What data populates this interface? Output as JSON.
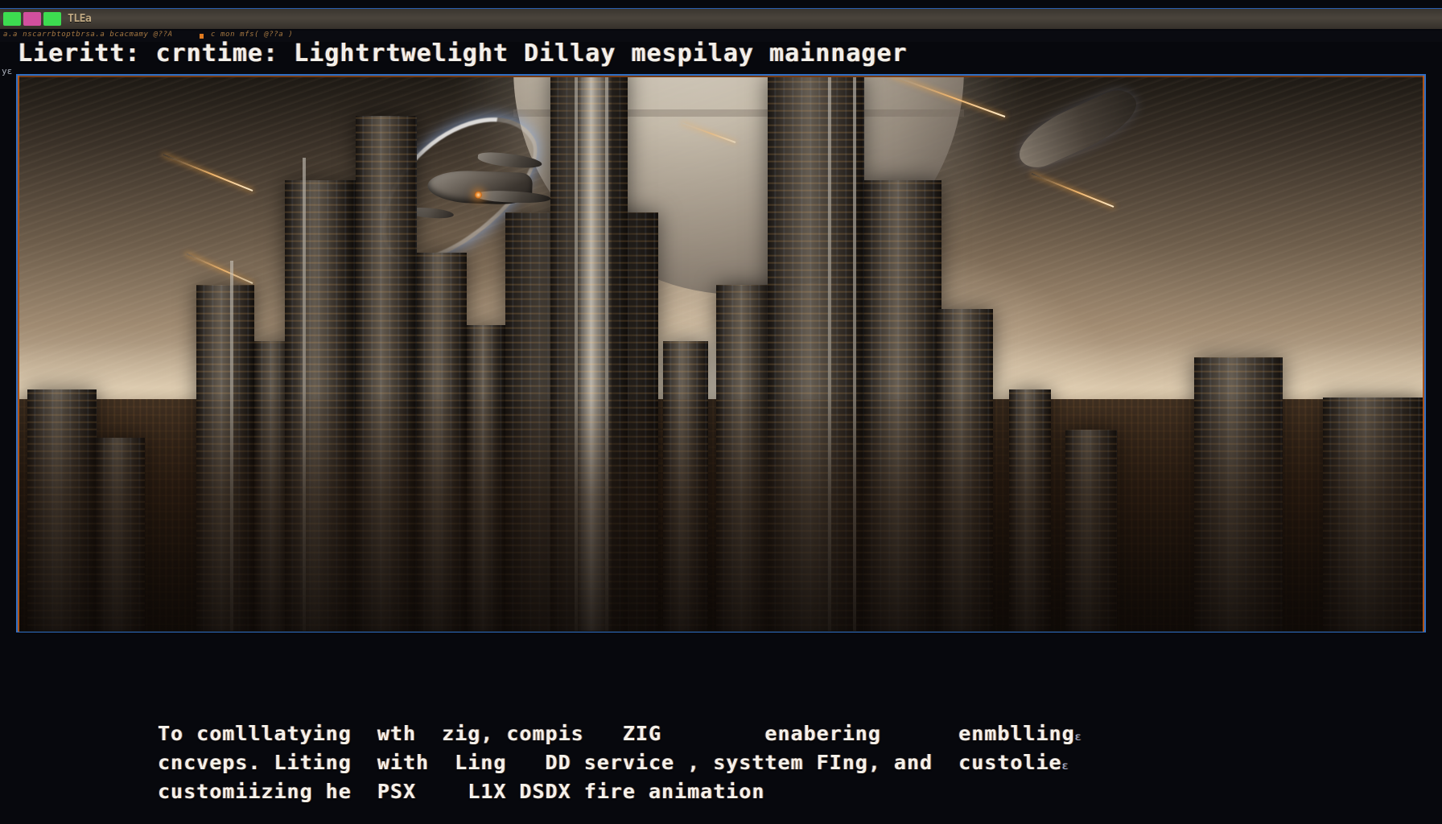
{
  "window": {
    "tabstrip": {
      "swatches": [
        {
          "name": "swatch-green-1",
          "color": "#3ddc50"
        },
        {
          "name": "swatch-magenta",
          "color": "#d24f9e"
        },
        {
          "name": "swatch-green-2",
          "color": "#3ddc50"
        }
      ],
      "label": "TLEa"
    },
    "microline": {
      "left": "a.a nscarrbtoptbrsa.a bcacmamy @??A",
      "middle": "c mon mfs( @??a )"
    },
    "header": {
      "title": "Lieritt: crntime: Lightrtwelight Dillay mespilay mainnager"
    },
    "edge_glyph": "yɛ"
  },
  "viewer": {
    "image_alt": "Futuristic sci-fi megacity skyline at dusk with a ringed planet on the horizon and a starship flying overhead",
    "frame_border_color": "#2f6fc4",
    "frame_accent_color": "#c85f19"
  },
  "caption": {
    "lines": [
      {
        "text": "To comlllatying  wth  zig, compis   ZIG        enabering      enmblling",
        "tail": "ɛ"
      },
      {
        "text": "cncveps. Liting  with  Ling   DD service , systtem FIng, and  custolie",
        "tail": "ɛ"
      },
      {
        "text": "customiizing he  PSX    L1X DSDX fire animation",
        "tail": ""
      }
    ]
  },
  "colors": {
    "background": "#07080d",
    "text_primary": "#f4f1ea",
    "accent_orange": "#e07a1f",
    "accent_blue": "#2f6fc4",
    "tab_label": "#bfa882"
  }
}
